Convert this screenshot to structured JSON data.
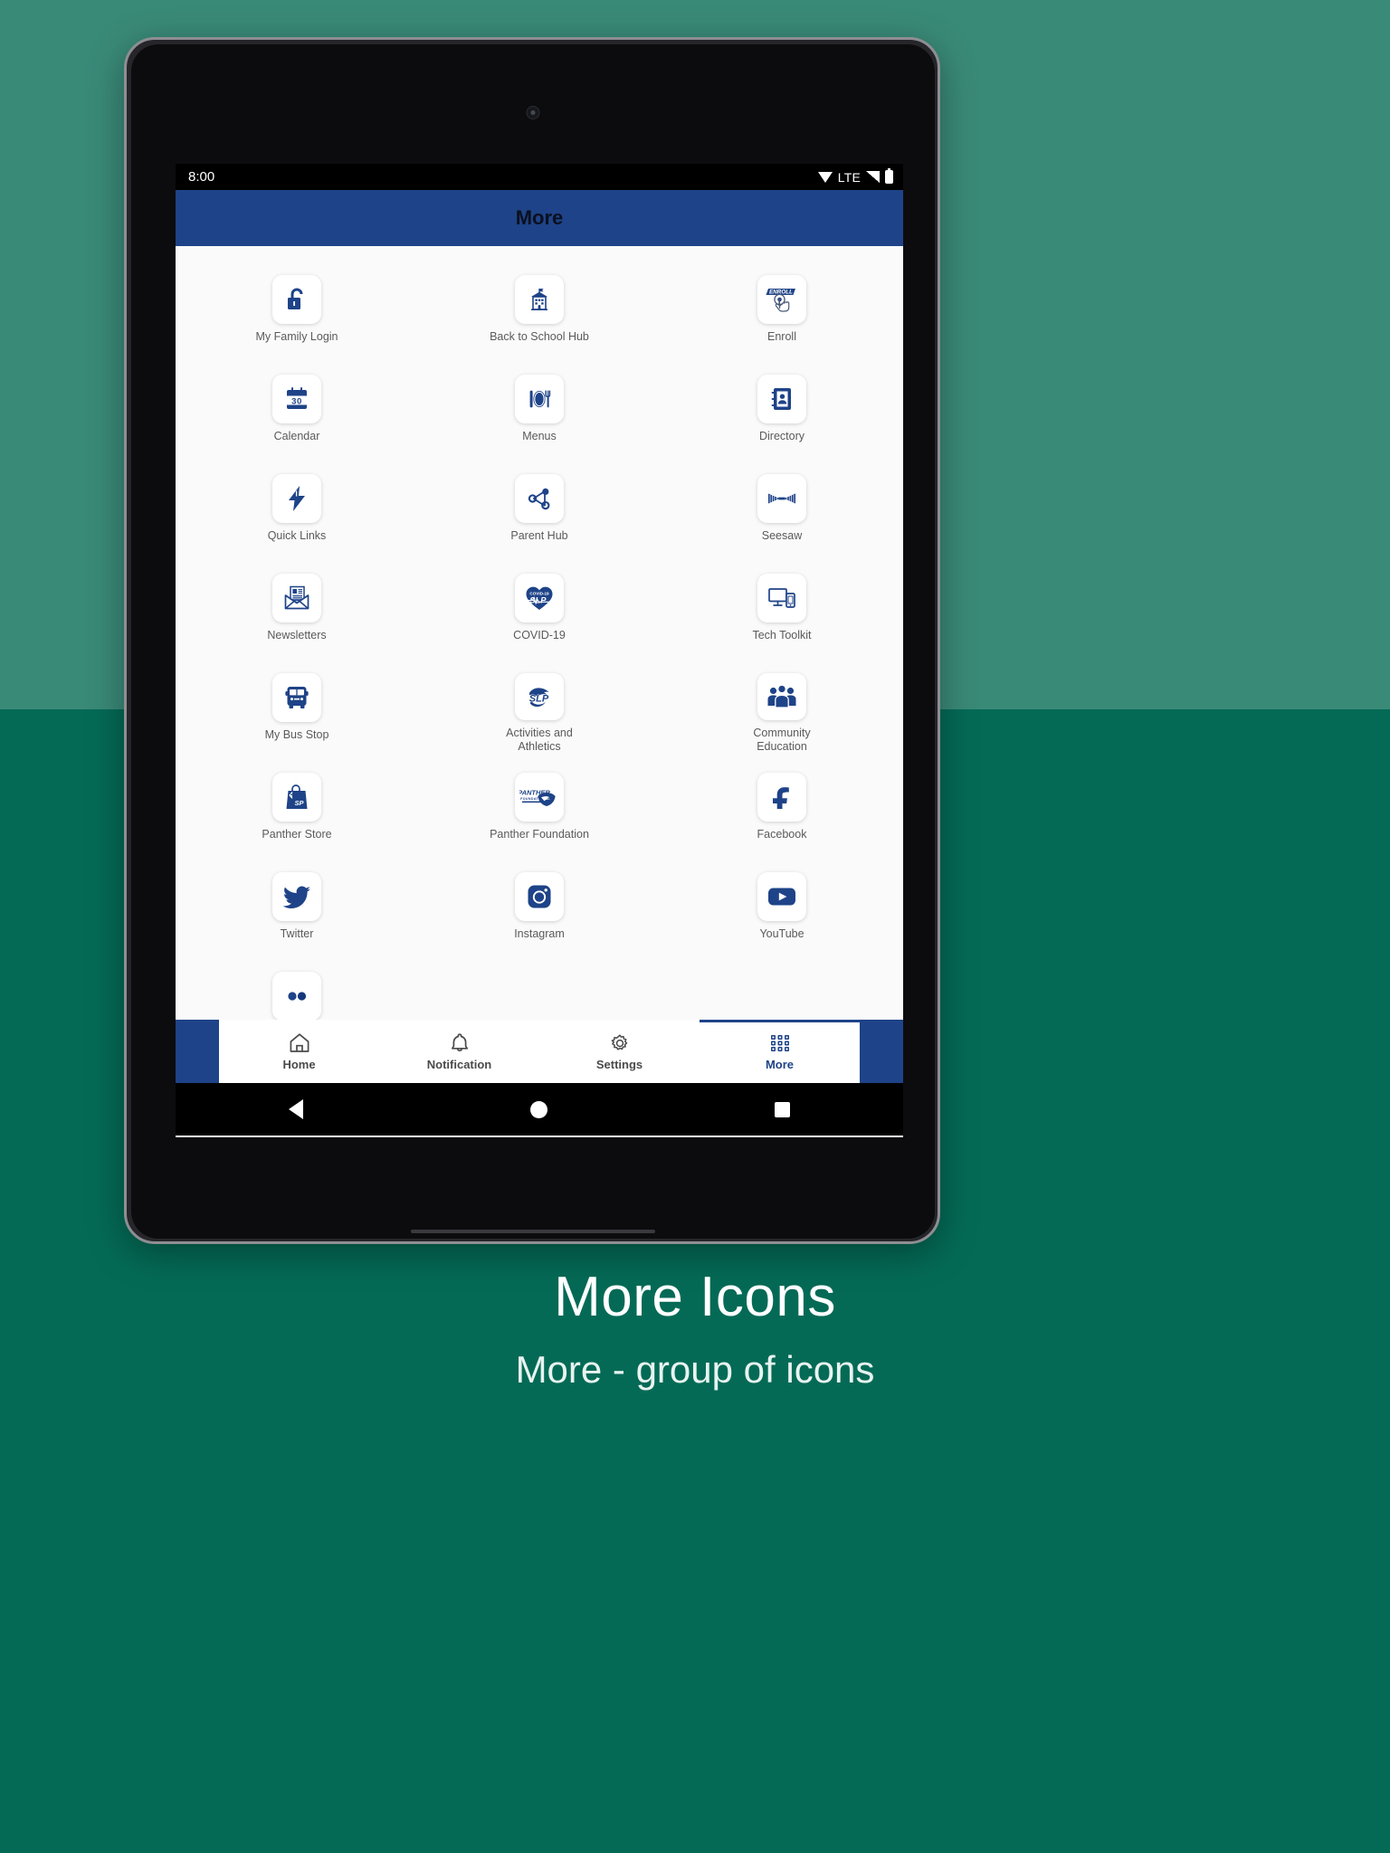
{
  "background": {
    "top_color": "#3a8a78",
    "bottom_color": "#046a56"
  },
  "device": {
    "frame_color": "#8e8e93",
    "camera_name": "front-camera"
  },
  "statusbar": {
    "time": "8:00",
    "network_label": "LTE",
    "icons": [
      "wifi-icon",
      "signal-icon",
      "battery-icon"
    ]
  },
  "appbar": {
    "title": "More",
    "background": "#1e4388"
  },
  "grid": {
    "items": [
      {
        "label": "My Family Login",
        "icon": "unlocked-padlock-icon"
      },
      {
        "label": "Back to School\nHub",
        "icon": "school-building-icon"
      },
      {
        "label": "Enroll",
        "icon": "enroll-tap-hand-icon"
      },
      {
        "label": "Calendar",
        "icon": "calendar-30-icon"
      },
      {
        "label": "Menus",
        "icon": "plate-fork-knife-icon"
      },
      {
        "label": "Directory",
        "icon": "address-book-icon"
      },
      {
        "label": "Quick Links",
        "icon": "lightning-bolt-icon"
      },
      {
        "label": "Parent Hub",
        "icon": "share-network-icon"
      },
      {
        "label": "Seesaw",
        "icon": "seesaw-bowtie-icon"
      },
      {
        "label": "Newsletters",
        "icon": "envelope-newsletter-icon"
      },
      {
        "label": "COVID-19",
        "icon": "heart-covid19-slp-icon"
      },
      {
        "label": "Tech Toolkit",
        "icon": "monitor-phone-icon"
      },
      {
        "label": "My Bus Stop",
        "icon": "school-bus-icon"
      },
      {
        "label": "Activities and\nAthletics",
        "icon": "slp-panther-icon"
      },
      {
        "label": "Community\nEducation",
        "icon": "people-group-icon"
      },
      {
        "label": "Panther Store",
        "icon": "shopping-bag-icon"
      },
      {
        "label": "Panther\nFoundation",
        "icon": "panther-foundation-icon"
      },
      {
        "label": "Facebook",
        "icon": "facebook-icon"
      },
      {
        "label": "Twitter",
        "icon": "twitter-bird-icon"
      },
      {
        "label": "Instagram",
        "icon": "instagram-icon"
      },
      {
        "label": "YouTube",
        "icon": "youtube-icon"
      },
      {
        "label": "",
        "icon": "flickr-dots-icon"
      }
    ],
    "icon_color": "#1e4388"
  },
  "bottomnav": {
    "items": [
      {
        "label": "Home",
        "icon": "home-icon",
        "active": false
      },
      {
        "label": "Notification",
        "icon": "bell-icon",
        "active": false
      },
      {
        "label": "Settings",
        "icon": "gear-icon",
        "active": false
      },
      {
        "label": "More",
        "icon": "grid-dots-icon",
        "active": true
      }
    ],
    "active_color": "#1e4388",
    "inactive_color": "#4a4a4a"
  },
  "androidnav": {
    "buttons": [
      "back-button",
      "home-button",
      "recents-button"
    ]
  },
  "caption": {
    "title": "More Icons",
    "subtitle": "More - group of icons"
  },
  "enroll_icon": {
    "banner_text": "ENROLL"
  },
  "covid_icon": {
    "top_text": "COVID-19",
    "main_text": "SLP"
  },
  "calendar_icon": {
    "day": "30"
  },
  "panther_foundation_icon": {
    "line1": "PANTHER",
    "line2": "FOUNDATION"
  },
  "slp_icon": {
    "text": "SLP"
  }
}
